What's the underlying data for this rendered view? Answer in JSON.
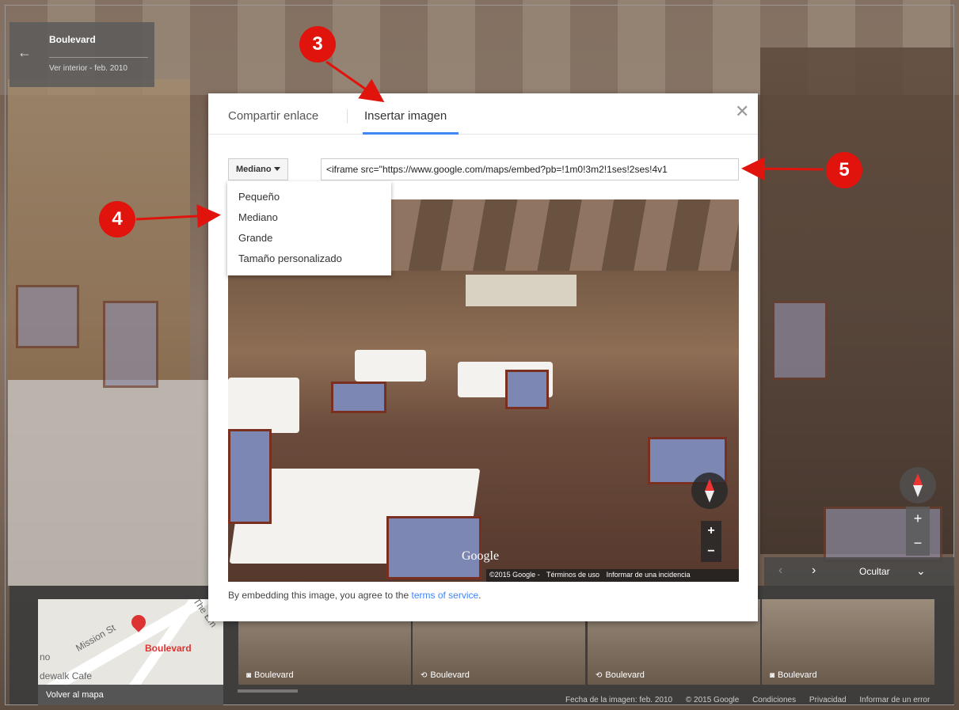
{
  "place": {
    "name": "Boulevard",
    "subtitle": "Ver interior - feb. 2010",
    "back_icon": "arrow-left-icon"
  },
  "dialog": {
    "tab_share": "Compartir enlace",
    "tab_embed": "Insertar imagen",
    "close_icon": "close-icon",
    "size_selected": "Mediano",
    "embed_code": "<iframe src=\"https://www.google.com/maps/embed?pb=!1m0!3m2!1ses!2ses!4v1",
    "size_options": [
      "Pequeño",
      "Mediano",
      "Grande",
      "Tamaño personalizado"
    ],
    "agree_text": "By embedding this image, you agree to the ",
    "agree_link": "terms of service",
    "agree_end": ".",
    "preview": {
      "google_mark": "Google",
      "copyright": "©2015 Google -",
      "terms": "Términos de uso",
      "report": "Informar de una incidencia",
      "zoom_in": "+",
      "zoom_out": "−"
    }
  },
  "annotations": {
    "badge3": "3",
    "badge4": "4",
    "badge5": "5",
    "color": "#e0140d"
  },
  "controls": {
    "zoom_in": "+",
    "zoom_out": "−",
    "prev": "‹",
    "next": "›",
    "hide": "Ocultar",
    "chevrons": "≪"
  },
  "filmstrip": {
    "map_labels": {
      "street": "Mission St",
      "place": "Boulevard",
      "left": "no",
      "cafe": "dewalk Cafe",
      "corner": "The Em"
    },
    "back_to_map": "Volver al mapa",
    "thumbs": [
      {
        "label": "Boulevard",
        "icon": "camera-icon"
      },
      {
        "label": "Boulevard",
        "icon": "360-icon"
      },
      {
        "label": "Boulevard",
        "icon": "360-icon"
      },
      {
        "label": "Boulevard",
        "icon": "camera-icon"
      }
    ]
  },
  "footer": {
    "date": "Fecha de la imagen: feb. 2010",
    "copyright": "© 2015 Google",
    "conditions": "Condiciones",
    "privacy": "Privacidad",
    "report": "Informar de un error"
  },
  "colors": {
    "accent_blue": "#4285f4",
    "annotation_red": "#e0140d"
  }
}
